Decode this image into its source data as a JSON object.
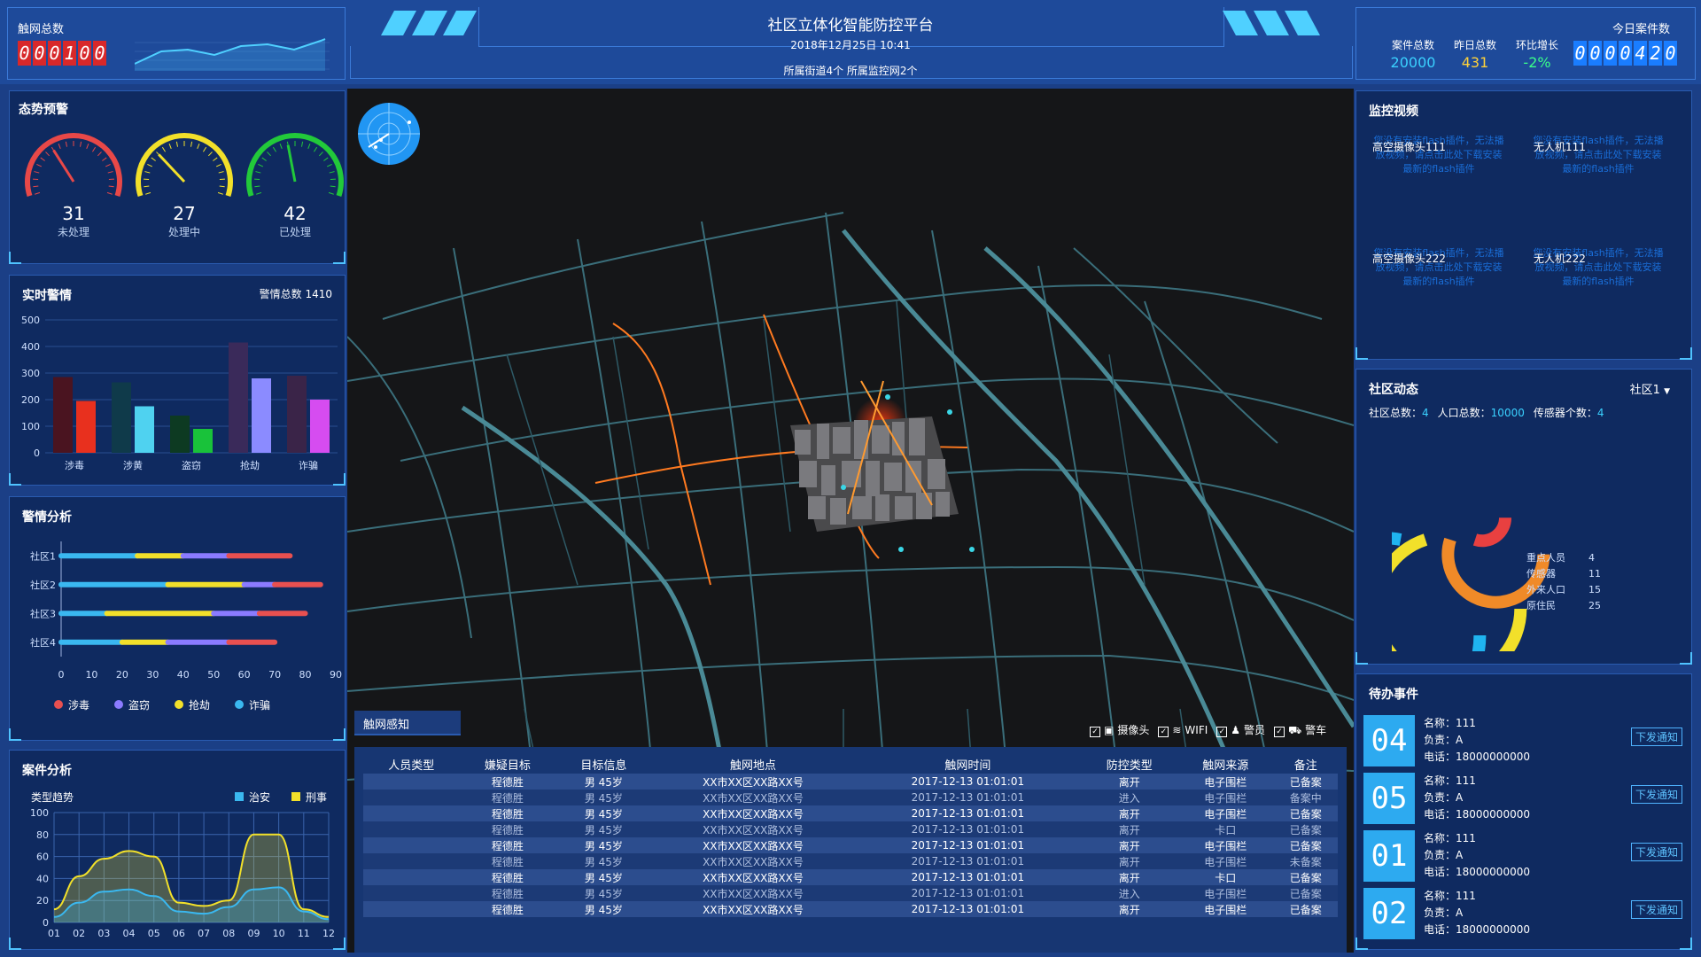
{
  "header": {
    "title": "社区立体化智能防控平台",
    "datetime": "2018年12月25日 10:41",
    "sub": "所属街道4个 所属监控网2个",
    "left_title": "触网总数",
    "left_digits": [
      "0",
      "0",
      "0",
      "1",
      "0",
      "0"
    ],
    "right_title": "今日案件数",
    "right_digits": [
      "0",
      "0",
      "0",
      "0",
      "4",
      "2",
      "0"
    ],
    "stats": [
      {
        "label": "案件总数",
        "value": "20000",
        "color": "#3ad1ff"
      },
      {
        "label": "昨日总数",
        "value": "431",
        "color": "#ffd23a"
      },
      {
        "label": "环比增长",
        "value": "-2%",
        "color": "#3aff8a"
      }
    ]
  },
  "situation": {
    "title": "态势预警",
    "gauges": [
      {
        "value": "31",
        "label": "未处理",
        "color": "#e84848",
        "level": 0.35
      },
      {
        "value": "27",
        "label": "处理中",
        "color": "#f2e02a",
        "level": 0.3
      },
      {
        "value": "42",
        "label": "已处理",
        "color": "#22c93a",
        "level": 0.45
      }
    ]
  },
  "realtime": {
    "title": "实时警情",
    "total": "警情总数 1410"
  },
  "analysis": {
    "title": "警情分析",
    "legend": [
      {
        "name": "涉毒",
        "color": "#e85050"
      },
      {
        "name": "盗窃",
        "color": "#8b7bff"
      },
      {
        "name": "抢劫",
        "color": "#f2e02a"
      },
      {
        "name": "诈骗",
        "color": "#3ab8f0"
      }
    ]
  },
  "cases": {
    "title": "案件分析",
    "subtitle": "类型趋势",
    "legend": [
      {
        "name": "治安",
        "color": "#3ab8f0"
      },
      {
        "name": "刑事",
        "color": "#f2e02a"
      }
    ]
  },
  "chart_data": [
    {
      "type": "bar",
      "categories": [
        "涉毒",
        "涉黄",
        "盗窃",
        "抢劫",
        "诈骗"
      ],
      "series": [
        {
          "values": [
            285,
            265,
            140,
            415,
            290
          ],
          "colors": [
            "#4a1420",
            "#0f3a4a",
            "#0d3a22",
            "#3a2a5a",
            "#3a2448"
          ]
        },
        {
          "values": [
            195,
            175,
            90,
            280,
            200
          ],
          "colors": [
            "#e8301e",
            "#4fd2f0",
            "#19c23a",
            "#8b8bff",
            "#d64cf0"
          ]
        }
      ],
      "ylim": [
        0,
        500
      ],
      "yticks": [
        0,
        100,
        200,
        300,
        400,
        500
      ]
    },
    {
      "type": "bar",
      "orientation": "horizontal-stacked",
      "categories": [
        "社区1",
        "社区2",
        "社区3",
        "社区4"
      ],
      "series": [
        {
          "name": "诈骗",
          "values": [
            25,
            35,
            15,
            20
          ],
          "color": "#3ab8f0"
        },
        {
          "name": "抢劫",
          "values": [
            15,
            25,
            35,
            15
          ],
          "color": "#f2e02a"
        },
        {
          "name": "盗窃",
          "values": [
            15,
            10,
            15,
            20
          ],
          "color": "#8b7bff"
        },
        {
          "name": "涉毒",
          "values": [
            20,
            15,
            15,
            15
          ],
          "color": "#e85050"
        }
      ],
      "xlim": [
        0,
        90
      ],
      "xticks": [
        0,
        10,
        20,
        30,
        40,
        50,
        60,
        70,
        80,
        90
      ]
    },
    {
      "type": "area",
      "x": [
        "01",
        "02",
        "03",
        "04",
        "05",
        "06",
        "07",
        "08",
        "09",
        "10",
        "11",
        "12"
      ],
      "series": [
        {
          "name": "刑事",
          "values": [
            12,
            42,
            58,
            65,
            60,
            18,
            15,
            20,
            80,
            80,
            12,
            5
          ],
          "color": "#f2e02a"
        },
        {
          "name": "治安",
          "values": [
            5,
            18,
            28,
            30,
            24,
            10,
            8,
            14,
            30,
            32,
            10,
            3
          ],
          "color": "#3ab8f0"
        }
      ],
      "ylim": [
        0,
        100
      ],
      "yticks": [
        0,
        20,
        40,
        60,
        80,
        100
      ]
    }
  ],
  "map": {
    "title": "触网感知",
    "filters": [
      "摄像头",
      "WIFI",
      "警员",
      "警车"
    ],
    "columns": [
      "人员类型",
      "嫌疑目标",
      "目标信息",
      "触网地点",
      "触网时间",
      "防控类型",
      "触网来源",
      "备注"
    ],
    "rows": [
      [
        "",
        "程德胜",
        "男 45岁",
        "XX市XX区XX路XX号",
        "2017-12-13 01:01:01",
        "离开",
        "电子围栏",
        "已备案"
      ],
      [
        "",
        "程德胜",
        "男 45岁",
        "XX市XX区XX路XX号",
        "2017-12-13 01:01:01",
        "进入",
        "电子围栏",
        "备案中"
      ],
      [
        "",
        "程德胜",
        "男 45岁",
        "XX市XX区XX路XX号",
        "2017-12-13 01:01:01",
        "离开",
        "电子围栏",
        "已备案"
      ],
      [
        "",
        "程德胜",
        "男 45岁",
        "XX市XX区XX路XX号",
        "2017-12-13 01:01:01",
        "离开",
        "卡口",
        "已备案"
      ],
      [
        "",
        "程德胜",
        "男 45岁",
        "XX市XX区XX路XX号",
        "2017-12-13 01:01:01",
        "离开",
        "电子围栏",
        "已备案"
      ],
      [
        "",
        "程德胜",
        "男 45岁",
        "XX市XX区XX路XX号",
        "2017-12-13 01:01:01",
        "离开",
        "电子围栏",
        "未备案"
      ],
      [
        "",
        "程德胜",
        "男 45岁",
        "XX市XX区XX路XX号",
        "2017-12-13 01:01:01",
        "离开",
        "卡口",
        "已备案"
      ],
      [
        "",
        "程德胜",
        "男 45岁",
        "XX市XX区XX路XX号",
        "2017-12-13 01:01:01",
        "进入",
        "电子围栏",
        "已备案"
      ],
      [
        "",
        "程德胜",
        "男 45岁",
        "XX市XX区XX路XX号",
        "2017-12-13 01:01:01",
        "离开",
        "电子围栏",
        "已备案"
      ]
    ]
  },
  "video": {
    "title": "监控视频",
    "cams": [
      {
        "label": "高空摄像头111",
        "tip": "您没有安装flash插件，无法播放视频，请点击此处下载安装最新的flash插件"
      },
      {
        "label": "无人机111",
        "tip": "您没有安装flash插件，无法播放视频，请点击此处下载安装最新的flash插件"
      },
      {
        "label": "高空摄像头222",
        "tip": "您没有安装flash插件，无法播放视频，请点击此处下载安装最新的flash插件"
      },
      {
        "label": "无人机222",
        "tip": "您没有安装flash插件，无法播放视频，请点击此处下载安装最新的flash插件"
      }
    ]
  },
  "community": {
    "title": "社区动态",
    "selector": "社区1",
    "stats": [
      {
        "label": "社区总数：",
        "value": "4"
      },
      {
        "label": "人口总数：",
        "value": "10000"
      },
      {
        "label": "传感器个数：",
        "value": "4"
      }
    ],
    "rings": [
      {
        "name": "原住民",
        "value": "25",
        "color": "#1fb4f0",
        "fraction": 0.78
      },
      {
        "name": "外来人口",
        "value": "15",
        "color": "#f2e02a",
        "fraction": 0.7
      },
      {
        "name": "传感器",
        "value": "11",
        "color": "#f08a28",
        "fraction": 0.55
      },
      {
        "name": "重点人员",
        "value": "4",
        "color": "#e84040",
        "fraction": 0.3
      }
    ]
  },
  "tasks": {
    "title": "待办事件",
    "items": [
      {
        "num": "04",
        "name": "名称：111",
        "owner": "负责：A",
        "phone": "电话：18000000000",
        "btn": "下发通知"
      },
      {
        "num": "05",
        "name": "名称：111",
        "owner": "负责：A",
        "phone": "电话：18000000000",
        "btn": "下发通知"
      },
      {
        "num": "01",
        "name": "名称：111",
        "owner": "负责：A",
        "phone": "电话：18000000000",
        "btn": "下发通知"
      },
      {
        "num": "02",
        "name": "名称：111",
        "owner": "负责：A",
        "phone": "电话：18000000000",
        "btn": "下发通知"
      }
    ]
  }
}
